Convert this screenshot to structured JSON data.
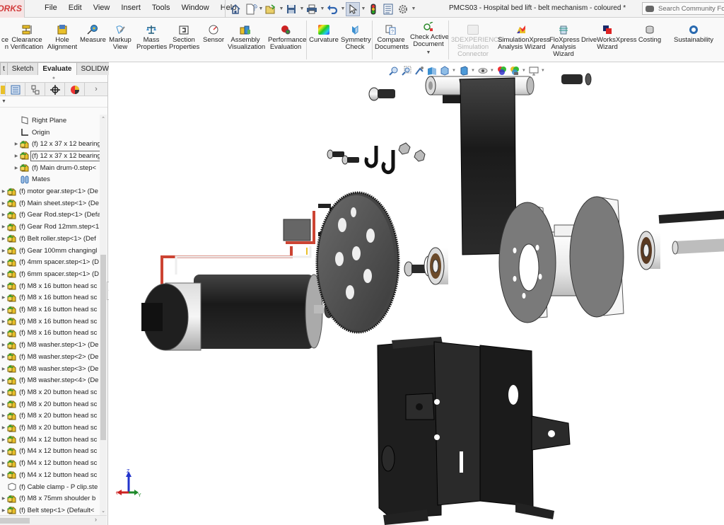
{
  "app": {
    "logo_text": "ORKS",
    "document_title": "PMCS03 - Hospital bed lift - belt mechanism - coloured *",
    "search_placeholder": "Search Community Forum"
  },
  "menu": [
    "File",
    "Edit",
    "View",
    "Insert",
    "Tools",
    "Window",
    "Help"
  ],
  "quick_access": [
    "home",
    "new-document",
    "open",
    "save",
    "print",
    "undo",
    "select",
    "rebuild",
    "file-properties",
    "options"
  ],
  "ribbon": {
    "tools": [
      {
        "id": "interference-detection",
        "label": "ce\nn",
        "icon": "interference-icon"
      },
      {
        "id": "clearance-verification",
        "label": "Clearance\nVerification",
        "icon": "clearance-icon"
      },
      {
        "id": "hole-alignment",
        "label": "Hole\nAlignment",
        "icon": "hole-alignment-icon"
      },
      {
        "id": "measure",
        "label": "Measure",
        "icon": "measure-icon"
      },
      {
        "id": "markup-view",
        "label": "Markup\nView",
        "icon": "markup-icon"
      },
      {
        "id": "mass-properties",
        "label": "Mass\nProperties",
        "icon": "scale-icon"
      },
      {
        "id": "section-properties",
        "label": "Section\nProperties",
        "icon": "section-icon"
      },
      {
        "id": "sensor",
        "label": "Sensor",
        "icon": "gauge-icon"
      },
      {
        "id": "assembly-visualization",
        "label": "Assembly\nVisualization",
        "icon": "assembly-viz-icon"
      },
      {
        "id": "performance-evaluation",
        "label": "Performance\nEvaluation",
        "icon": "traffic-light-icon"
      },
      {
        "id": "curvature",
        "label": "Curvature",
        "icon": "curvature-icon"
      },
      {
        "id": "symmetry-check",
        "label": "Symmetry\nCheck",
        "icon": "symmetry-icon"
      },
      {
        "id": "compare-documents",
        "label": "Compare\nDocuments",
        "icon": "compare-icon"
      },
      {
        "id": "check-active-document",
        "label": "Check Active\nDocument",
        "icon": "check-doc-icon"
      },
      {
        "id": "3dexperience-simulation",
        "label": "3DEXPERIENCE\nSimulation\nConnector",
        "icon": "3dx-icon",
        "disabled": true
      },
      {
        "id": "simulationxpress",
        "label": "SimulationXpress\nAnalysis Wizard",
        "icon": "simxpress-icon"
      },
      {
        "id": "floxpress",
        "label": "FloXpress\nAnalysis\nWizard",
        "icon": "floxpress-icon"
      },
      {
        "id": "driveworksxpress",
        "label": "DriveWorksXpress\nWizard",
        "icon": "driveworks-icon"
      },
      {
        "id": "costing",
        "label": "Costing",
        "icon": "costing-icon"
      },
      {
        "id": "sustainability",
        "label": "Sustainability",
        "icon": "sustainability-icon"
      }
    ]
  },
  "command_tabs": [
    {
      "label": "t",
      "active": false
    },
    {
      "label": "Sketch",
      "active": false
    },
    {
      "label": "Evaluate",
      "active": true
    },
    {
      "label": "SOLIDWORKS Add-Ins",
      "active": false
    }
  ],
  "feature_manager": {
    "tabs": [
      "feature-tree",
      "property-manager",
      "configuration-manager",
      "dimxpert",
      "display-manager"
    ],
    "tree": [
      {
        "label": "Right Plane",
        "icon": "plane-icon",
        "indent": 1,
        "expand": false
      },
      {
        "label": "Origin",
        "icon": "origin-icon",
        "indent": 1,
        "expand": false
      },
      {
        "label": "(f) 12 x 37 x 12 bearing",
        "icon": "component-icon",
        "indent": 1,
        "expand": true
      },
      {
        "label": "(f) 12 x 37 x 12 bearing",
        "icon": "component-icon",
        "indent": 1,
        "expand": true,
        "selected": true
      },
      {
        "label": "(f) Main drum-0.step<",
        "icon": "component-icon",
        "indent": 1,
        "expand": true
      },
      {
        "label": "Mates",
        "icon": "mates-icon",
        "indent": 1,
        "expand": false
      },
      {
        "label": "(f) motor gear.step<1> (De",
        "icon": "component-icon",
        "indent": 0,
        "expand": true
      },
      {
        "label": "(f) Main sheet.step<1> (De",
        "icon": "component-icon",
        "indent": 0,
        "expand": true
      },
      {
        "label": "(f) Gear Rod.step<1> (Defa",
        "icon": "component-icon",
        "indent": 0,
        "expand": true
      },
      {
        "label": "(f) Gear Rod 12mm.step<1",
        "icon": "component-icon",
        "indent": 0,
        "expand": true
      },
      {
        "label": "(f) Belt roller.step<1> (Def",
        "icon": "component-icon",
        "indent": 0,
        "expand": true
      },
      {
        "label": "(f) Gear 100mm changingl",
        "icon": "component-icon",
        "indent": 0,
        "expand": true
      },
      {
        "label": "(f) 4mm spacer.step<1> (D",
        "icon": "component-icon",
        "indent": 0,
        "expand": true
      },
      {
        "label": "(f) 6mm spacer.step<1> (D",
        "icon": "component-icon",
        "indent": 0,
        "expand": true
      },
      {
        "label": "(f) M8 x 16 button head sc",
        "icon": "component-icon",
        "indent": 0,
        "expand": true
      },
      {
        "label": "(f) M8 x 16 button head sc",
        "icon": "component-icon",
        "indent": 0,
        "expand": true
      },
      {
        "label": "(f) M8 x 16 button head sc",
        "icon": "component-icon",
        "indent": 0,
        "expand": true
      },
      {
        "label": "(f) M8 x 16 button head sc",
        "icon": "component-icon",
        "indent": 0,
        "expand": true
      },
      {
        "label": "(f) M8 x 16 button head sc",
        "icon": "component-icon",
        "indent": 0,
        "expand": true
      },
      {
        "label": "(f) M8 washer.step<1> (De",
        "icon": "component-icon",
        "indent": 0,
        "expand": true
      },
      {
        "label": "(f) M8 washer.step<2> (De",
        "icon": "component-icon",
        "indent": 0,
        "expand": true
      },
      {
        "label": "(f) M8 washer.step<3> (De",
        "icon": "component-icon",
        "indent": 0,
        "expand": true
      },
      {
        "label": "(f) M8 washer.step<4> (De",
        "icon": "component-icon",
        "indent": 0,
        "expand": true
      },
      {
        "label": "(f) M8 x 20 button head sc",
        "icon": "component-icon",
        "indent": 0,
        "expand": true
      },
      {
        "label": "(f) M8 x 20 button head sc",
        "icon": "component-icon",
        "indent": 0,
        "expand": true
      },
      {
        "label": "(f) M8 x 20 button head sc",
        "icon": "component-icon",
        "indent": 0,
        "expand": true
      },
      {
        "label": "(f) M8 x 20 button head sc",
        "icon": "component-icon",
        "indent": 0,
        "expand": true
      },
      {
        "label": "(f) M4 x 12 button head sc",
        "icon": "component-icon",
        "indent": 0,
        "expand": true
      },
      {
        "label": "(f) M4 x 12 button head sc",
        "icon": "component-icon",
        "indent": 0,
        "expand": true
      },
      {
        "label": "(f) M4 x 12 button head sc",
        "icon": "component-icon",
        "indent": 0,
        "expand": true
      },
      {
        "label": "(f) M4 x 12 button head sc",
        "icon": "component-icon",
        "indent": 0,
        "expand": true
      },
      {
        "label": "(f) Cable clamp - P clip.ste",
        "icon": "part-icon",
        "indent": 0,
        "expand": false
      },
      {
        "label": "(f) M8 x 75mm shoulder b",
        "icon": "component-icon",
        "indent": 0,
        "expand": true
      },
      {
        "label": "(f) Belt step<1> (Default<",
        "icon": "component-icon",
        "indent": 0,
        "expand": true
      }
    ]
  },
  "heads_up_toolbar": [
    "zoom-to-fit",
    "zoom-to-area",
    "previous-view",
    "section-view",
    "view-orientation",
    "display-style",
    "hide-show-items",
    "edit-appearance",
    "apply-scene",
    "view-settings"
  ],
  "triad": {
    "x_label": "X",
    "y_label": "Y",
    "z_label": "Z"
  },
  "colors": {
    "accent": "#d23a3a",
    "component_yellow": "#e8c23a",
    "component_green": "#3d9a3d",
    "axis_x": "#cc2222",
    "axis_y": "#1f8a2a",
    "axis_z": "#2233cc"
  }
}
